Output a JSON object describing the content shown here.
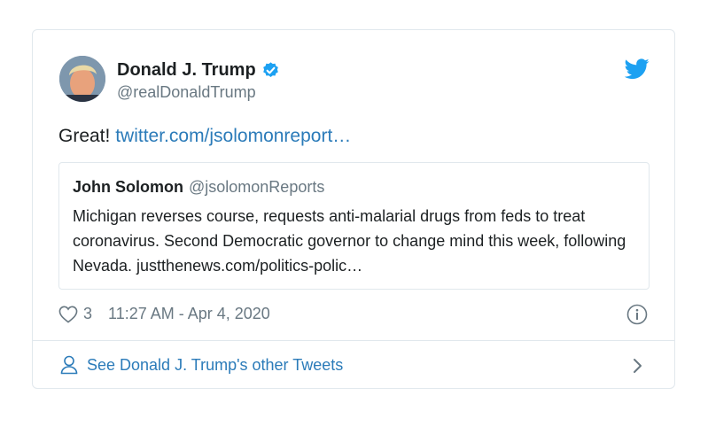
{
  "tweet": {
    "author_name": "Donald J. Trump",
    "author_handle": "@realDonaldTrump",
    "text": "Great!",
    "link": "twitter.com/jsolomonreport…",
    "likes": "3",
    "timestamp": "11:27 AM - Apr 4, 2020",
    "icons": {
      "verified": "verified-badge-icon",
      "logo": "twitter-bird-icon",
      "like": "heart-icon",
      "info": "info-icon"
    }
  },
  "quoted": {
    "name": "John Solomon",
    "handle": "@jsolomonReports",
    "text": "Michigan reverses course, requests anti-malarial drugs from feds to treat coronavirus. Second Democratic governor to change mind this week, following Nevada. justthenews.com/politics-polic…"
  },
  "footer": {
    "label": "See Donald J. Trump's other Tweets"
  },
  "colors": {
    "link": "#2b7bb9",
    "brand": "#1da1f2",
    "muted": "#697882",
    "border": "#e1e8ed"
  }
}
